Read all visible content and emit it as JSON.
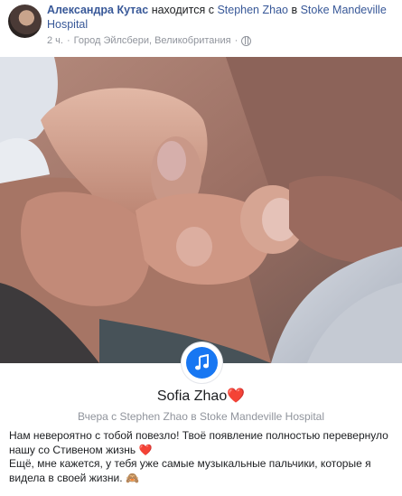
{
  "post": {
    "author": "Александра Кутас",
    "activity": "находится с",
    "tagged_person": "Stephen Zhao",
    "in_word": "в",
    "place": "Stoke Mandeville Hospital",
    "time": "2 ч.",
    "separator": "·",
    "location": "Город Эйлсбери, Великобритания",
    "separator2": "·",
    "privacy_icon": "globe-icon"
  },
  "card": {
    "badge_icon": "music-note-icon",
    "badge_color": "#1877f2",
    "name": "Sofia Zhao",
    "name_emoji": "❤️",
    "subtitle": "Вчера с Stephen Zhao в Stoke Mandeville Hospital",
    "text_line1": "Нам невероятно с тобой повезло! Твоё появление полностью перевернуло нашу со Стивеном жизнь",
    "text_line1_emoji": "❤️",
    "text_line2": "Ещё, мне кажется, у тебя уже самые музыкальные пальчики, которые я видела в своей жизни.",
    "text_line2_emoji": "🙈"
  },
  "colors": {
    "link": "#385898",
    "meta": "#90949c"
  }
}
